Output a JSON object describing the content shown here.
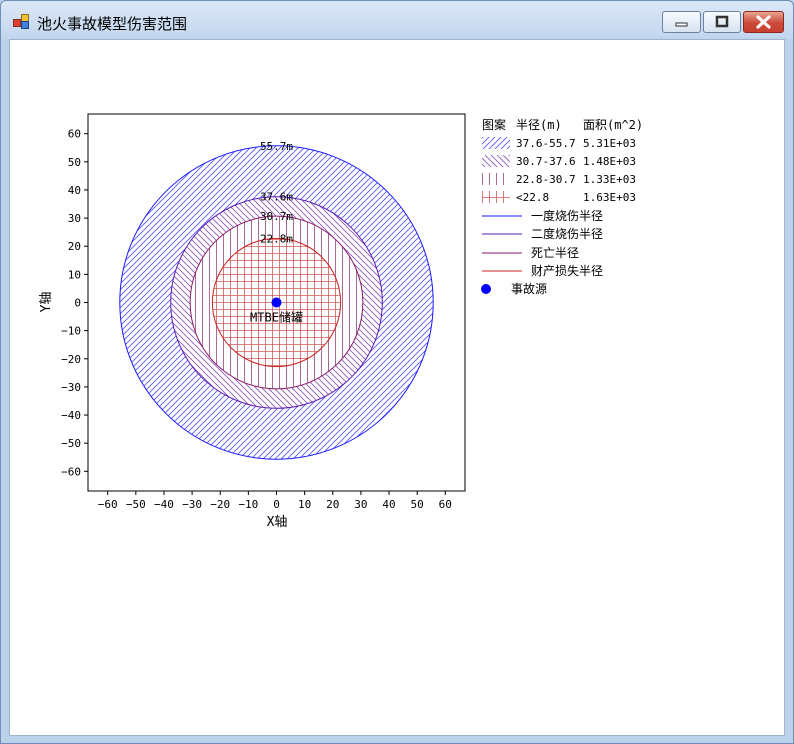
{
  "window": {
    "title": "池火事故模型伤害范围"
  },
  "chart_data": {
    "type": "scatter",
    "xlabel": "X轴",
    "ylabel": "Y轴",
    "xlim": [
      -67,
      67
    ],
    "ylim": [
      -67,
      67
    ],
    "xticks": [
      -60,
      -50,
      -40,
      -30,
      -20,
      -10,
      0,
      10,
      20,
      30,
      40,
      50,
      60
    ],
    "yticks": [
      -60,
      -50,
      -40,
      -30,
      -20,
      -10,
      0,
      10,
      20,
      30,
      40,
      50,
      60
    ],
    "grid": false,
    "circles": [
      {
        "radius": 55.7,
        "label": "55.7m",
        "color": "#1a1aff"
      },
      {
        "radius": 37.6,
        "label": "37.6m",
        "color": "#5a1ab5"
      },
      {
        "radius": 30.7,
        "label": "30.7m",
        "color": "#8a1a6a"
      },
      {
        "radius": 22.8,
        "label": "22.8m",
        "color": "#cc2020"
      }
    ],
    "source": {
      "x": 0,
      "y": 0,
      "label": "MTBE储罐",
      "color": "#0000ff"
    },
    "legend": {
      "position": "right",
      "headers": [
        "图案",
        "半径(m)",
        "面积(m^2)"
      ],
      "zones": [
        {
          "range": "37.6-55.7",
          "area": "5.31E+03",
          "pattern": "diag-right",
          "color": "#5a5aff"
        },
        {
          "range": "30.7-37.6",
          "area": "1.48E+03",
          "pattern": "diag-left",
          "color": "#8a5ab5"
        },
        {
          "range": "22.8-30.7",
          "area": "1.33E+03",
          "pattern": "vertical",
          "color": "#a05a8a"
        },
        {
          "range": "<22.8",
          "area": "1.63E+03",
          "pattern": "grid",
          "color": "#d05a5a"
        }
      ],
      "lines": [
        {
          "label": "一度烧伤半径",
          "color": "#1a1aff"
        },
        {
          "label": "二度烧伤半径",
          "color": "#5a1ab5"
        },
        {
          "label": "死亡半径",
          "color": "#8a1a6a"
        },
        {
          "label": "财产损失半径",
          "color": "#cc2020"
        }
      ],
      "marker_label": "事故源"
    }
  }
}
